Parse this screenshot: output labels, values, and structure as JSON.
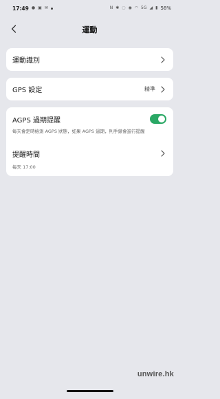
{
  "status_bar": {
    "time": "17:49",
    "left_icons": [
      "messenger-icon",
      "chat-icon",
      "mail-icon",
      "dot-icon"
    ],
    "right_icons": [
      "nfc-icon",
      "bluetooth-icon",
      "mute-icon",
      "eye-icon",
      "wifi-icon",
      "5g-icon",
      "signal-icon"
    ],
    "signal_label": "5G",
    "battery": "58%"
  },
  "header": {
    "title": "運動"
  },
  "sections": {
    "recognition": {
      "label": "運動識別"
    },
    "gps": {
      "label": "GPS 設定",
      "value": "精準"
    },
    "agps": {
      "label": "AGPS 過期提醒",
      "enabled": true,
      "description": "每天會定時檢測 AGPS 狀態，如果 AGPS 過期，則手錶會進行提醒"
    },
    "reminder_time": {
      "label": "提醒時間",
      "value": "每天 17:00"
    }
  },
  "watermark": "unwire.hk",
  "colors": {
    "accent": "#2aa865",
    "background": "#e6e7ec",
    "card": "#ffffff"
  }
}
